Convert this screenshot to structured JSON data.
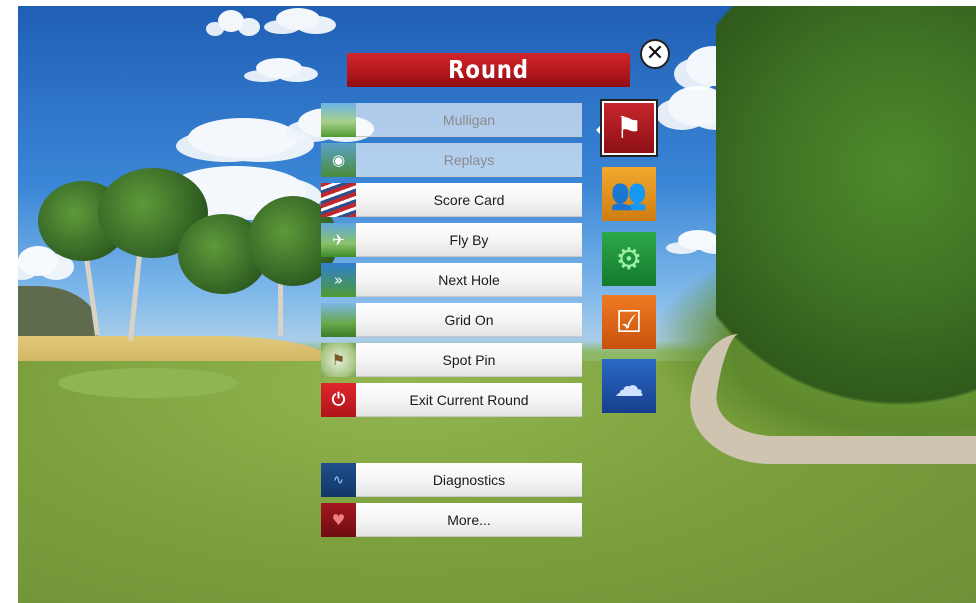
{
  "menu": {
    "title": "Round",
    "close_icon": "✕",
    "items": [
      {
        "label": "Mulligan",
        "icon": "mulligan-icon",
        "enabled": false
      },
      {
        "label": "Replays",
        "icon": "replay-icon",
        "enabled": false
      },
      {
        "label": "Score Card",
        "icon": "scorecard-icon",
        "enabled": true
      },
      {
        "label": "Fly By",
        "icon": "flyby-icon",
        "enabled": true
      },
      {
        "label": "Next Hole",
        "icon": "next-hole-icon",
        "enabled": true
      },
      {
        "label": "Grid On",
        "icon": "grid-icon",
        "enabled": true
      },
      {
        "label": "Spot Pin",
        "icon": "spot-pin-icon",
        "enabled": true
      },
      {
        "label": "Exit Current Round",
        "icon": "power-icon",
        "enabled": true
      }
    ],
    "extra_items": [
      {
        "label": "Diagnostics",
        "icon": "pulse-icon"
      },
      {
        "label": "More...",
        "icon": "more-icon"
      }
    ]
  },
  "category_tabs": [
    {
      "name": "round",
      "icon": "flag-icon",
      "active": true
    },
    {
      "name": "players",
      "icon": "players-icon",
      "active": false
    },
    {
      "name": "settings",
      "icon": "gears-icon",
      "active": false
    },
    {
      "name": "options",
      "icon": "checkbox-icon",
      "active": false
    },
    {
      "name": "weather",
      "icon": "rain-cloud-icon",
      "active": false
    }
  ],
  "colors": {
    "title_bar": "#b1161c",
    "round_tab": "#c7262d",
    "players_tab": "#f2a92d",
    "settings_tab": "#2ea84a",
    "options_tab": "#f07a23",
    "weather_tab": "#2b68c7"
  }
}
